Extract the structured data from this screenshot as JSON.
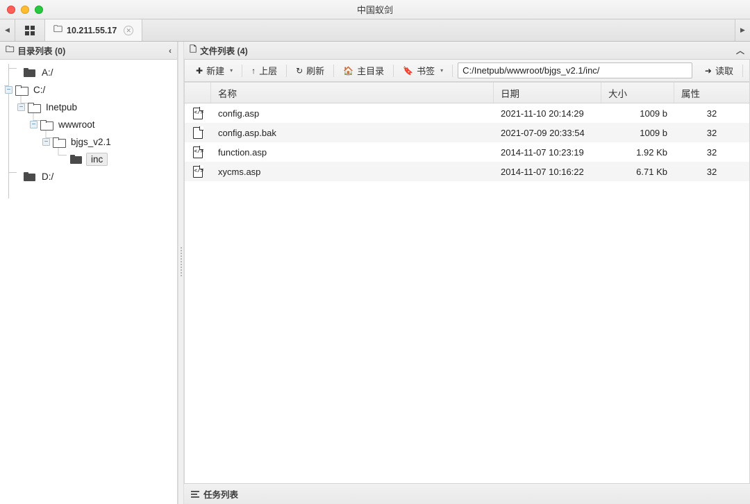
{
  "window": {
    "title": "中国蚁剑",
    "controls": [
      "close",
      "minimize",
      "zoom"
    ]
  },
  "tabbar": {
    "scroll_left": "◀",
    "scroll_right": "▶",
    "tabs": [
      {
        "label": "10.211.55.17",
        "active": true,
        "closable": true
      }
    ]
  },
  "tree_panel": {
    "title": "目录列表 (0)",
    "collapse_chevron": "‹",
    "nodes": [
      {
        "label": "A:/",
        "depth": 0,
        "state": "collapsed",
        "folder": "closed",
        "selected": false
      },
      {
        "label": "C:/",
        "depth": 0,
        "state": "expanded",
        "folder": "open",
        "selected": false
      },
      {
        "label": "Inetpub",
        "depth": 1,
        "state": "expanded",
        "folder": "open",
        "selected": false
      },
      {
        "label": "wwwroot",
        "depth": 2,
        "state": "expanded",
        "folder": "open",
        "selected": false
      },
      {
        "label": "bjgs_v2.1",
        "depth": 3,
        "state": "expanded",
        "folder": "open",
        "selected": false
      },
      {
        "label": "inc",
        "depth": 4,
        "state": "leaf",
        "folder": "closed",
        "selected": true
      },
      {
        "label": "D:/",
        "depth": 0,
        "state": "collapsed",
        "folder": "closed",
        "selected": false
      }
    ]
  },
  "file_panel": {
    "title": "文件列表 (4)",
    "collapse_chevron": "︿",
    "toolbar": {
      "new_label": "新建",
      "new_icon": "plus-circle-icon",
      "up_label": "上层",
      "up_icon": "arrow-up-icon",
      "refresh_label": "刷新",
      "refresh_icon": "refresh-icon",
      "home_label": "主目录",
      "home_icon": "home-icon",
      "bookmark_label": "书签",
      "bookmark_icon": "bookmark-icon",
      "caret": "▾",
      "path_value": "C:/Inetpub/wwwroot/bjgs_v2.1/inc/",
      "path_placeholder": "C:/",
      "read_label": "读取",
      "read_icon": "arrow-right-icon"
    },
    "columns": [
      "",
      "名称",
      "日期",
      "大小",
      "属性"
    ],
    "rows": [
      {
        "icon": "code-file-icon",
        "name": "config.asp",
        "date": "2021-11-10 20:14:29",
        "size": "1009 b",
        "attr": "32"
      },
      {
        "icon": "plain-file-icon",
        "name": "config.asp.bak",
        "date": "2021-07-09 20:33:54",
        "size": "1009 b",
        "attr": "32"
      },
      {
        "icon": "code-file-icon",
        "name": "function.asp",
        "date": "2014-11-07 10:23:19",
        "size": "1.92 Kb",
        "attr": "32"
      },
      {
        "icon": "code-file-icon",
        "name": "xycms.asp",
        "date": "2014-11-07 10:16:22",
        "size": "6.71 Kb",
        "attr": "32"
      }
    ]
  },
  "statusbar": {
    "task_list_label": "任务列表",
    "task_list_icon": "list-icon"
  },
  "colors": {
    "close": "#ff5f57",
    "minimize": "#febc2e",
    "zoom": "#28c840",
    "row_stripe": "#f5f5f5",
    "panel_header": "#eeeeee"
  }
}
